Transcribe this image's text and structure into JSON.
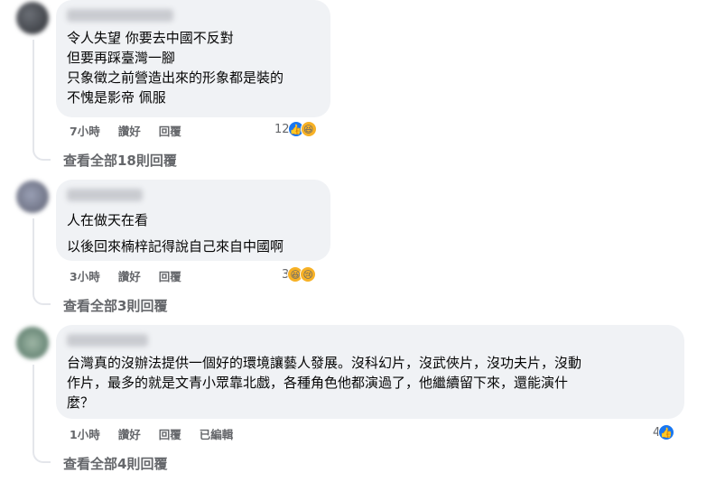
{
  "colors": {
    "bubble": "#f0f2f5",
    "secondary_text": "#65676b",
    "like_blue": "#1877f2",
    "emoji_yellow": "#f7b125"
  },
  "comments": [
    {
      "text": "令人失望 你要去中國不反對\n但要再踩臺灣一腳\n只象徵之前營造出來的形象都是裝的\n不愧是影帝 佩服",
      "actions": {
        "time": "7小時",
        "like": "讚好",
        "reply": "回覆"
      },
      "reaction_count": "12",
      "reaction_icons": [
        "like-icon",
        "haha-icon"
      ],
      "view_replies": "查看全部18則回覆"
    },
    {
      "text": "人在做天在看\n以後回來楠梓記得說自己來自中國啊",
      "actions": {
        "time": "3小時",
        "like": "讚好",
        "reply": "回覆"
      },
      "reaction_count": "3",
      "reaction_icons": [
        "haha-icon",
        "sad-icon"
      ],
      "view_replies": "查看全部3則回覆"
    },
    {
      "text": "台灣真的沒辦法提供一個好的環境讓藝人發展。沒科幻片，沒武俠片，沒功夫片，沒動\n作片，最多的就是文青小眾靠北戲，各種角色他都演過了，他繼續留下來，還能演什\n麼？",
      "actions": {
        "time": "1小時",
        "like": "讚好",
        "reply": "回覆",
        "edited": "已編輯"
      },
      "reaction_count": "4",
      "reaction_icons": [
        "like-icon"
      ],
      "view_replies": "查看全部4則回覆"
    }
  ]
}
